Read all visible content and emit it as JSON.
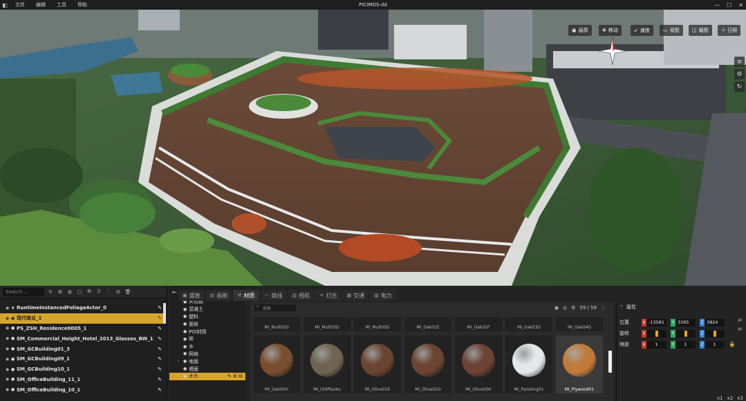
{
  "app": {
    "title": "PICIMOS-dd",
    "menu": [
      "文件",
      "编辑",
      "工具",
      "帮助"
    ]
  },
  "viewport_toolbar": [
    "画质",
    "移动",
    "速度",
    "视图",
    "截图",
    "日照"
  ],
  "outliner": {
    "search_placeholder": "Search...",
    "items": [
      {
        "label": "RuntimeInstancedFoliageActor_0",
        "selected": false
      },
      {
        "label": "现代商业_1",
        "selected": true
      },
      {
        "label": "PS_ZSH_Residence0005_1",
        "selected": false
      },
      {
        "label": "SM_Commercial_Height_Hotel_2013_Glasses_BW_1",
        "selected": false
      },
      {
        "label": "SM_GCBuilding01_3",
        "selected": false
      },
      {
        "label": "SM_GCBuilding09_1",
        "selected": false
      },
      {
        "label": "SM_GCBuilding10_1",
        "selected": false
      },
      {
        "label": "SM_OfficeBuilding_11_1",
        "selected": false
      },
      {
        "label": "SM_OfficeBuilding_10_1",
        "selected": false
      }
    ]
  },
  "categories": [
    {
      "label": "天花板",
      "selected": false
    },
    {
      "label": "混凝土",
      "selected": false
    },
    {
      "label": "塑料",
      "selected": false
    },
    {
      "label": "瓷砖",
      "selected": false
    },
    {
      "label": "POI材质",
      "selected": false
    },
    {
      "label": "砖",
      "selected": false
    },
    {
      "label": "水",
      "selected": false
    },
    {
      "label": "网格",
      "selected": false
    },
    {
      "label": "地面",
      "selected": false
    },
    {
      "label": "墙面",
      "selected": false
    },
    {
      "label": "木头",
      "selected": true
    }
  ],
  "tabs": [
    {
      "label": "摆放",
      "active": false
    },
    {
      "label": "画刷",
      "active": false
    },
    {
      "label": "材质",
      "active": true
    },
    {
      "label": "路线",
      "active": false
    },
    {
      "label": "相机",
      "active": false
    },
    {
      "label": "灯光",
      "active": false
    },
    {
      "label": "交通",
      "active": false
    },
    {
      "label": "电力",
      "active": false
    }
  ],
  "assets": {
    "filter_placeholder": "搜索",
    "count": "59 / 59",
    "top_row": [
      "MI_Mult02D",
      "MI_Mult03D",
      "MI_Mult05D",
      "MI_Oak01E",
      "MI_Oak02F",
      "MI_Oak03G",
      "MI_Oak04G"
    ],
    "items": [
      {
        "name": "MI_Oak05H",
        "color": "#7a4e30"
      },
      {
        "name": "MI_OldPlanks",
        "color": "#6e6450"
      },
      {
        "name": "MI_Olive01E",
        "color": "#6a4532"
      },
      {
        "name": "MI_Olive02G",
        "color": "#6b4432"
      },
      {
        "name": "MI_Olive03H",
        "color": "#6a4334"
      },
      {
        "name": "MI_Paneling01",
        "color": "#e4e6e8"
      },
      {
        "name": "MI_Plywood01",
        "color": "#c27a3a",
        "selected": true
      }
    ]
  },
  "properties": {
    "title": "属性",
    "rows": [
      {
        "label": "位置",
        "x": "-13581",
        "y": "3395",
        "z": "3824"
      },
      {
        "label": "旋转",
        "x": "",
        "y": "",
        "z": ""
      },
      {
        "label": "缩放",
        "x": "1",
        "y": "1",
        "z": "1"
      }
    ]
  },
  "zoom_buttons": [
    "x1",
    "x2",
    "x3"
  ]
}
